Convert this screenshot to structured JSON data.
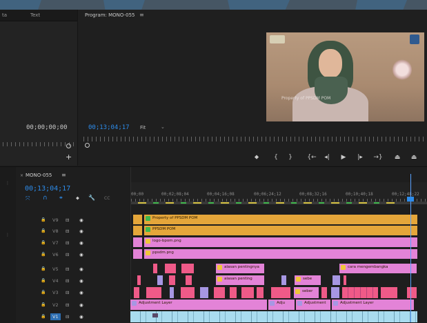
{
  "colors": {
    "accent_blue": "#2d8ceb",
    "clip_orange": "#e5a63a",
    "clip_pink": "#e383d7",
    "clip_red": "#ef5a88",
    "clip_lavender": "#a797e3",
    "clip_cyan": "#a9dcef",
    "fx_yellow": "#f0c63a",
    "fx_green": "#3fb84c"
  },
  "source_monitor": {
    "tab_left": "ta",
    "tab_text": "Text",
    "timecode": "00;00;00;00"
  },
  "program_monitor": {
    "title": "Program: MONO-055",
    "menu_icon": "hamburger-icon",
    "timecode": "00;13;04;17",
    "zoom": "Fit",
    "video_watermark": "Property of PPSDM POM"
  },
  "transport": {
    "buttons": [
      {
        "name": "marker-icon",
        "glyph": "⬥"
      },
      {
        "name": "mark-in-icon",
        "glyph": "{"
      },
      {
        "name": "mark-out-icon",
        "glyph": "}"
      },
      {
        "name": "go-to-in-icon",
        "glyph": "{←"
      },
      {
        "name": "step-back-icon",
        "glyph": "◂|"
      },
      {
        "name": "play-icon",
        "glyph": "▶"
      },
      {
        "name": "step-forward-icon",
        "glyph": "|▸"
      },
      {
        "name": "go-to-out-icon",
        "glyph": "→}"
      },
      {
        "name": "lift-icon",
        "glyph": "⏏"
      },
      {
        "name": "extract-icon",
        "glyph": "⏏"
      }
    ]
  },
  "timeline": {
    "sequence_name": "MONO-055",
    "timecode": "00;13;04;17",
    "ruler_labels": [
      "00;00",
      "00;02;08;04",
      "00;04;16;08",
      "00;06;24;12",
      "00;08;32;16",
      "00;10;40;18",
      "00;12;48;22"
    ],
    "tracks": [
      {
        "label": "V9",
        "highlight": false
      },
      {
        "label": "V8",
        "highlight": false
      },
      {
        "label": "V7",
        "highlight": false
      },
      {
        "label": "V6",
        "highlight": false
      },
      {
        "label": "V5",
        "highlight": false
      },
      {
        "label": "V4",
        "highlight": false
      },
      {
        "label": "V3",
        "highlight": false
      },
      {
        "label": "V2",
        "highlight": false
      },
      {
        "label": "V1",
        "highlight": true
      }
    ],
    "clip_labels": {
      "v9": "Property of PPSDM POM",
      "v8": "PPSDM POM",
      "v7": "logo-bpom.png",
      "v6": "ppsdm.png",
      "v5_a": "alasan pentingnya",
      "v5_b": "cara mengembangka",
      "v4_a": "alasan penting",
      "v4_b": "sebe",
      "v3_a": "seber",
      "v2_a": "Adjustment Layer",
      "v2_b": "Adju",
      "v2_c": "Adjustment",
      "v2_d": "Adjustment Layer"
    }
  }
}
